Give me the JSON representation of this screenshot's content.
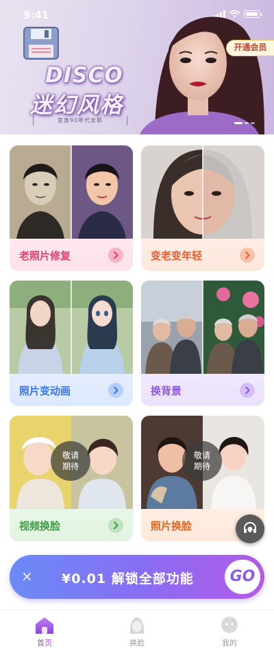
{
  "status_bar": {
    "time": "9:41"
  },
  "banner": {
    "title_line1": "DISCO",
    "title_line2": "迷幻风格",
    "subtitle": "变身90年代女郎",
    "vip_label": "开通会员",
    "page_indicator": {
      "total": 3,
      "active": 1
    }
  },
  "features": [
    {
      "label": "老照片修复",
      "accent": "#e3406a"
    },
    {
      "label": "变老变年轻",
      "accent": "#ef5c29"
    },
    {
      "label": "照片变动画",
      "accent": "#3a75e8"
    },
    {
      "label": "换背景",
      "accent": "#8c56e4"
    },
    {
      "label": "视频换脸",
      "accent": "#3f9a44",
      "badge_line1": "敬请",
      "badge_line2": "期待"
    },
    {
      "label": "照片换脸",
      "accent": "#e4641f",
      "badge_line1": "敬请",
      "badge_line2": "期待"
    }
  ],
  "promo": {
    "close_symbol": "×",
    "text": "¥0.01 解锁全部功能",
    "go_label": "GO"
  },
  "tabbar": {
    "items": [
      {
        "label": "首页",
        "icon": "home-icon",
        "active": true
      },
      {
        "label": "换脸",
        "icon": "face-icon",
        "active": false
      },
      {
        "label": "我的",
        "icon": "profile-icon",
        "active": false
      }
    ],
    "active_color": "#9a4fe6"
  }
}
